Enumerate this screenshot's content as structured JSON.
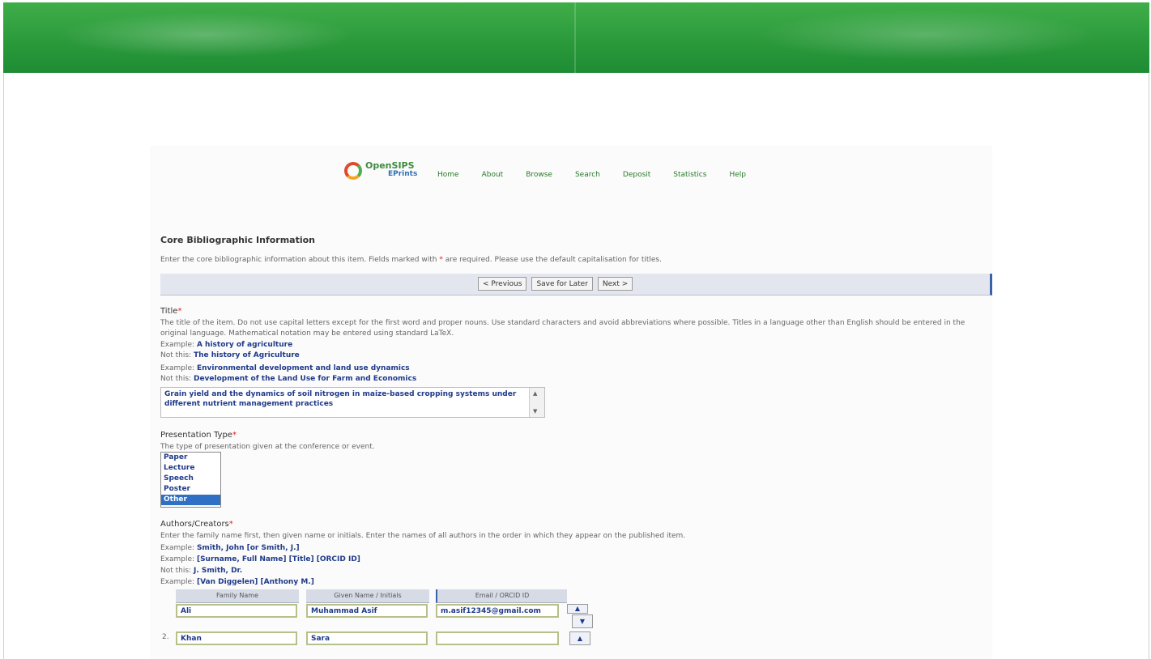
{
  "nav": [
    "Home",
    "About",
    "Browse",
    "Search",
    "Deposit",
    "Statistics",
    "Help"
  ],
  "logo": {
    "text": "OpenSIPS",
    "sub": "EPrints"
  },
  "form": {
    "heading": "Core Bibliographic Information",
    "intro": "Enter the core bibliographic information about this item. Fields marked with ",
    "intro_req": "*",
    "intro_tail": " are required. Please use the default capitalisation for titles.",
    "buttons": [
      "< Previous",
      "Save for Later",
      "Next >"
    ]
  },
  "title_section": {
    "label": "Title",
    "required": "*",
    "desc": "The title of the item. Do not use capital letters except for the first word and proper nouns. Use standard characters and avoid abbreviations where possible. Titles in a language other than English should be entered in the original language. Mathematical notation may be entered using standard LaTeX.",
    "examples": [
      {
        "prefix": "Example:",
        "text": "A history of agriculture"
      },
      {
        "prefix": "Not this:",
        "text": "The history of Agriculture"
      },
      {
        "prefix": "Example:",
        "text": "Environmental development and land use dynamics"
      },
      {
        "prefix": "Not this:",
        "text": "Development of the Land Use for Farm and Economics"
      }
    ],
    "value": "Grain yield and the dynamics of soil nitrogen in maize-based cropping systems under different nutrient management practices"
  },
  "presentation": {
    "label": "Presentation Type",
    "required": "*",
    "desc": "The type of presentation given at the conference or event.",
    "options": [
      "Paper",
      "Lecture",
      "Speech",
      "Poster",
      "Other"
    ],
    "selected": "Other"
  },
  "creators": {
    "label": "Authors/Creators",
    "required": "*",
    "desc": "Enter the family name first, then given name or initials. Enter the names of all authors in the order in which they appear on the published item.",
    "examples": [
      {
        "prefix": "Example:",
        "text": "Smith, John   [or Smith, J.]"
      },
      {
        "prefix": "Example:",
        "text": "[Surname, Full Name] [Title] [ORCID ID]"
      },
      {
        "prefix": "Not this:",
        "text": "J. Smith, Dr."
      },
      {
        "prefix": "Example:",
        "text": "[Van Diggelen] [Anthony M.]"
      }
    ],
    "columns": [
      "Family Name",
      "Given Name / Initials",
      "Email / ORCID ID"
    ],
    "rows": [
      {
        "family": "Ali",
        "given": "Muhammad Asif",
        "email": "m.asif12345@gmail.com"
      },
      {
        "family": "Khan",
        "given": "Sara",
        "email": ""
      }
    ],
    "row_marker": "2."
  }
}
